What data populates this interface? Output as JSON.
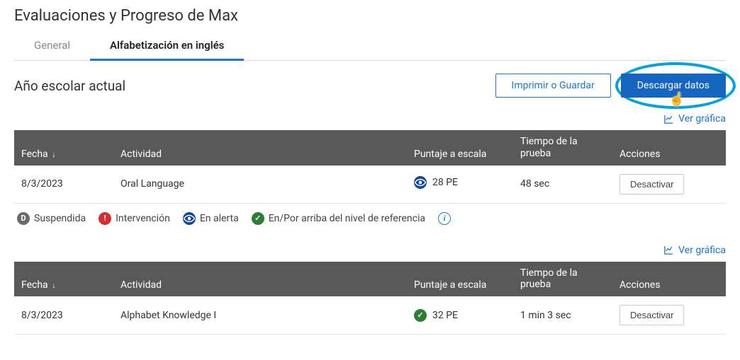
{
  "page_title": "Evaluaciones y Progreso de Max",
  "tabs": {
    "general": "General",
    "literacy": "Alfabetización en inglés"
  },
  "year_heading": "Año escolar actual",
  "buttons": {
    "print": "Imprimir o Guardar",
    "download": "Descargar datos",
    "deactivate": "Desactivar"
  },
  "links": {
    "view_chart": "Ver gráfica"
  },
  "columns": {
    "fecha": "Fecha",
    "actividad": "Actividad",
    "puntaje": "Puntaje a escala",
    "tiempo_l1": "Tiempo de la",
    "tiempo_l2": "prueba",
    "acciones": "Acciones"
  },
  "legend": {
    "suspendida": "Suspendida",
    "intervencion": "Intervención",
    "en_alerta": "En alerta",
    "referencia": "En/Por arriba del nivel de referencia"
  },
  "tables": [
    {
      "rows": [
        {
          "fecha": "8/3/2023",
          "actividad": "Oral Language",
          "status": "alert",
          "puntaje": "28 PE",
          "tiempo": "48 sec"
        }
      ]
    },
    {
      "rows": [
        {
          "fecha": "8/3/2023",
          "actividad": "Alphabet Knowledge I",
          "status": "ok",
          "puntaje": "32 PE",
          "tiempo": "1 min 3 sec"
        }
      ]
    }
  ]
}
